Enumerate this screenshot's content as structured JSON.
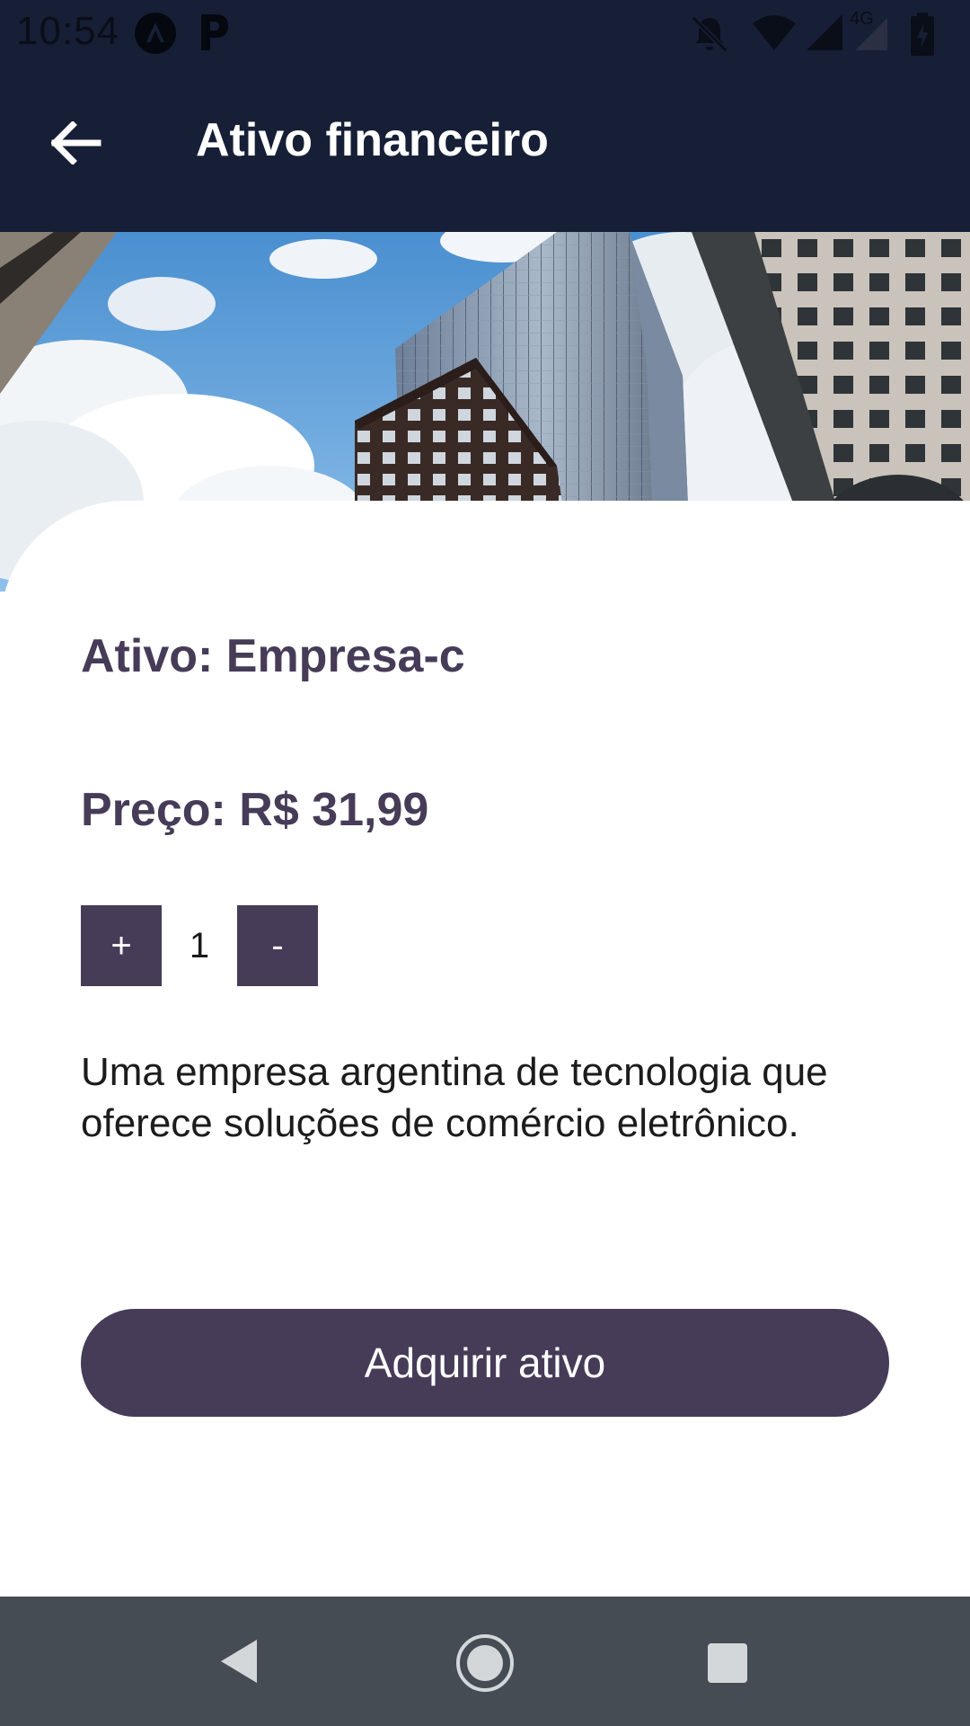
{
  "status_bar": {
    "time": "10:54",
    "network_label": "4G",
    "icons": [
      "app-circle-icon",
      "p-icon",
      "notifications-off-icon",
      "wifi-icon",
      "signal-icon",
      "signal-4g-icon",
      "battery-icon"
    ]
  },
  "app_bar": {
    "back_icon": "arrow-back-icon",
    "title": "Ativo financeiro"
  },
  "hero": {
    "image": "skyscrapers-photo",
    "sky_color": "#5b9fd8"
  },
  "asset": {
    "name_line": "Ativo: Empresa-c",
    "price_line": "Preço: R$ 31,99",
    "quantity": "1",
    "increment_label": "+",
    "decrement_label": "-",
    "description": "Uma empresa argentina de tecnologia que oferece soluções de comércio eletrônico."
  },
  "actions": {
    "acquire_label": "Adquirir ativo"
  },
  "colors": {
    "app_bar": "#161f36",
    "accent": "#463c58",
    "nav_bar": "#454c53"
  },
  "nav_bar": {
    "icons": [
      "nav-back-icon",
      "nav-home-icon",
      "nav-recents-icon"
    ]
  }
}
